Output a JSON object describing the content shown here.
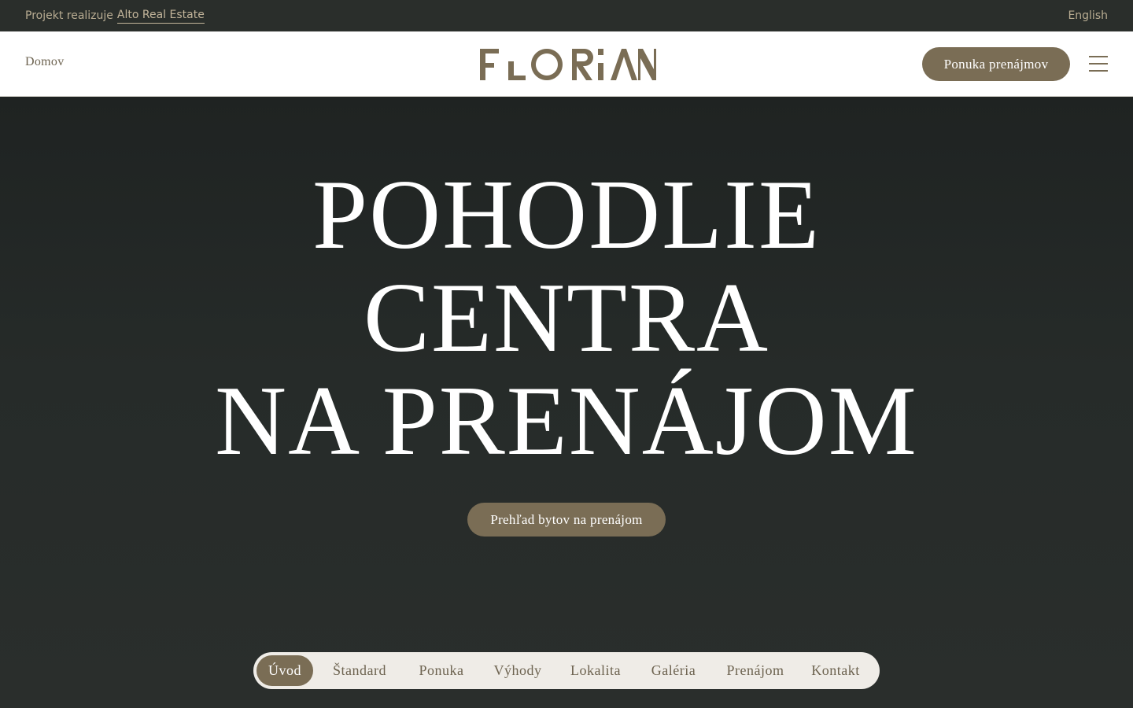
{
  "topbar": {
    "credit_prefix": "Projekt realizuje",
    "credit_link": "Alto Real Estate",
    "language": "English"
  },
  "header": {
    "home_link": "Domov",
    "logo_text": "FLORIAN",
    "cta_label": "Ponuka prenájmov",
    "menu_icon": "hamburger-menu-icon"
  },
  "hero": {
    "title_lines": [
      "POHODLIE",
      "CENTRA",
      "NA PRENÁJOM"
    ],
    "button_label": "Prehľad bytov na prenájom"
  },
  "section_nav": {
    "items": [
      {
        "label": "Úvod",
        "active": true
      },
      {
        "label": "Štandard",
        "active": false
      },
      {
        "label": "Ponuka",
        "active": false
      },
      {
        "label": "Výhody",
        "active": false
      },
      {
        "label": "Lokalita",
        "active": false
      },
      {
        "label": "Galéria",
        "active": false
      },
      {
        "label": "Prenájom",
        "active": false
      },
      {
        "label": "Kontakt",
        "active": false
      }
    ]
  },
  "colors": {
    "accent": "#7a6d55",
    "topbar_bg": "#2a2e2b",
    "hero_bg": "#222725",
    "nav_bg": "#efece7"
  }
}
